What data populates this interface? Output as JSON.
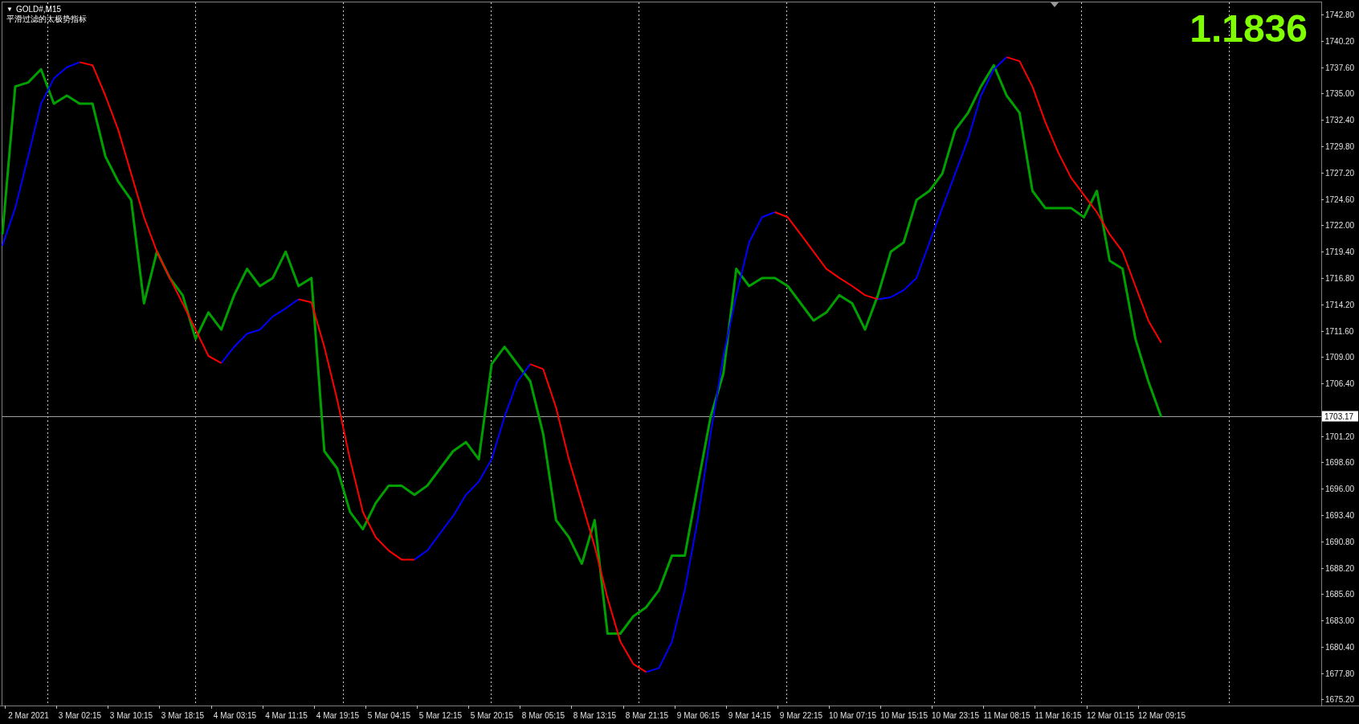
{
  "chart": {
    "header": {
      "arrow": "▼",
      "title": "GOLD#,M15",
      "indicator_name": "平滑过滤的太极势指标"
    },
    "indicator_value": "1.1836",
    "chart_data": {
      "type": "line",
      "categories": [
        null,
        null,
        "2 Mar 2021",
        null,
        null,
        null,
        "3 Mar 02:15",
        null,
        null,
        null,
        "3 Mar 10:15",
        null,
        null,
        null,
        "3 Mar 18:15",
        null,
        null,
        null,
        "4 Mar 03:15",
        null,
        null,
        null,
        "4 Mar 11:15",
        null,
        null,
        null,
        "4 Mar 19:15",
        null,
        null,
        null,
        "5 Mar 04:15",
        null,
        null,
        null,
        "5 Mar 12:15",
        null,
        null,
        null,
        "5 Mar 20:15",
        null,
        null,
        null,
        "8 Mar 05:15",
        null,
        null,
        null,
        "8 Mar 13:15",
        null,
        null,
        null,
        "8 Mar 21:15",
        null,
        null,
        null,
        "9 Mar 06:15",
        null,
        null,
        null,
        "9 Mar 14:15",
        null,
        null,
        null,
        "9 Mar 22:15",
        null,
        null,
        null,
        "10 Mar 07:15",
        null,
        null,
        null,
        "10 Mar 15:15",
        null,
        null,
        null,
        "10 Mar 23:15",
        null,
        null,
        null,
        "11 Mar 08:15",
        null,
        null,
        null,
        "11 Mar 16:15",
        null,
        null,
        null,
        "12 Mar 01:15",
        null,
        null,
        null,
        "12 Mar 09:15"
      ],
      "series": [
        {
          "color": "#00a000",
          "values": [
            1721.1,
            1735.7,
            1736.1,
            1737.4,
            1734.0,
            1734.8,
            1734.0,
            1734.0,
            1728.8,
            1726.3,
            1724.5,
            1714.3,
            1719.4,
            1716.8,
            1715.1,
            1710.8,
            1713.4,
            1711.7,
            1715.1,
            1717.7,
            1716.0,
            1716.8,
            1719.4,
            1716.0,
            1716.8,
            1699.7,
            1698.0,
            1693.7,
            1692.0,
            1694.6,
            1696.3,
            1696.3,
            1695.4,
            1696.3,
            1698.0,
            1699.7,
            1700.6,
            1698.9,
            1708.3,
            1710.0,
            1708.3,
            1706.6,
            1701.4,
            1692.9,
            1691.2,
            1688.6,
            1692.9,
            1681.7,
            1681.7,
            1683.4,
            1684.3,
            1686.0,
            1689.4,
            1689.4,
            1696.3,
            1703.1,
            1707.4,
            1717.7,
            1716.0,
            1716.8,
            1716.8,
            1716.0,
            1714.3,
            1712.6,
            1713.4,
            1715.1,
            1714.3,
            1711.7,
            1715.1,
            1719.4,
            1720.3,
            1724.5,
            1725.4,
            1727.1,
            1731.4,
            1733.1,
            1735.7,
            1737.8,
            1734.8,
            1733.1,
            1725.4,
            1723.7,
            1723.7,
            1723.7,
            1722.8,
            1725.4,
            1718.5,
            1717.7,
            1710.8,
            1706.6,
            1703.1
          ]
        },
        {
          "color": "#0000ff",
          "values": [
            1720.0,
            1723.7,
            1728.8,
            1734.0,
            1736.5,
            1737.6,
            1738.1,
            null,
            null,
            null,
            null,
            null,
            null,
            null,
            null,
            null,
            null,
            1708.4,
            1710.0,
            1711.3,
            1711.7,
            1713.0,
            1713.8,
            1714.7,
            null,
            null,
            null,
            null,
            null,
            null,
            null,
            null,
            1689.0,
            1689.9,
            1691.6,
            1693.3,
            1695.4,
            1696.7,
            1698.9,
            1703.1,
            1706.6,
            1708.3,
            null,
            null,
            null,
            null,
            null,
            null,
            null,
            null,
            1677.9,
            1678.3,
            1680.9,
            1686.0,
            1692.9,
            1701.4,
            1709.1,
            1715.1,
            1720.3,
            1722.8,
            1723.3,
            null,
            null,
            null,
            null,
            null,
            null,
            null,
            1714.7,
            1714.9,
            1715.6,
            1716.8,
            1720.3,
            1723.7,
            1727.1,
            1730.5,
            1734.8,
            1737.4,
            1738.6,
            null,
            null,
            null,
            null,
            null,
            null,
            null,
            null,
            null,
            null,
            null,
            null
          ]
        },
        {
          "color": "#ff0000",
          "values": [
            null,
            null,
            null,
            null,
            null,
            null,
            1738.1,
            1737.8,
            1734.8,
            1731.4,
            1727.1,
            1722.8,
            1719.4,
            1716.8,
            1714.3,
            1711.7,
            1709.1,
            1708.4,
            null,
            null,
            null,
            null,
            null,
            1714.7,
            1714.4,
            1710.0,
            1704.8,
            1698.9,
            1693.7,
            1691.2,
            1689.9,
            1689.0,
            1689.0,
            null,
            null,
            null,
            null,
            null,
            null,
            null,
            null,
            1708.3,
            1707.8,
            1704.0,
            1698.9,
            1694.6,
            1690.3,
            1685.2,
            1680.9,
            1678.7,
            1677.9,
            null,
            null,
            null,
            null,
            null,
            null,
            null,
            null,
            null,
            1723.3,
            1722.8,
            1721.1,
            1719.4,
            1717.7,
            1716.8,
            1716.0,
            1715.1,
            1714.7,
            null,
            null,
            null,
            null,
            null,
            null,
            null,
            null,
            null,
            1738.6,
            1738.2,
            1735.7,
            1732.2,
            1729.2,
            1726.7,
            1725.0,
            1723.3,
            1721.1,
            1719.4,
            1716.0,
            1712.6,
            1710.4
          ]
        }
      ],
      "ylim": [
        1674.6,
        1744.0
      ],
      "grid": true,
      "ref_lines": [
        {
          "axis": "y",
          "value": 1703.17,
          "label": "1703.17"
        }
      ],
      "yticks": [
        {
          "value": 1742.8,
          "label": "1742.80"
        },
        {
          "value": 1740.2,
          "label": "1740.20"
        },
        {
          "value": 1737.6,
          "label": "1737.60"
        },
        {
          "value": 1735.0,
          "label": "1735.00"
        },
        {
          "value": 1732.4,
          "label": "1732.40"
        },
        {
          "value": 1729.8,
          "label": "1729.80"
        },
        {
          "value": 1727.2,
          "label": "1727.20"
        },
        {
          "value": 1724.6,
          "label": "1724.60"
        },
        {
          "value": 1722.0,
          "label": "1722.00"
        },
        {
          "value": 1719.4,
          "label": "1719.40"
        },
        {
          "value": 1716.8,
          "label": "1716.80"
        },
        {
          "value": 1714.2,
          "label": "1714.20"
        },
        {
          "value": 1711.6,
          "label": "1711.60"
        },
        {
          "value": 1709.0,
          "label": "1709.00"
        },
        {
          "value": 1706.4,
          "label": "1706.40"
        },
        {
          "value": 1701.2,
          "label": "1701.20"
        },
        {
          "value": 1698.6,
          "label": "1698.60"
        },
        {
          "value": 1696.0,
          "label": "1696.00"
        },
        {
          "value": 1693.4,
          "label": "1693.40"
        },
        {
          "value": 1690.8,
          "label": "1690.80"
        },
        {
          "value": 1688.2,
          "label": "1688.20"
        },
        {
          "value": 1685.6,
          "label": "1685.60"
        },
        {
          "value": 1683.0,
          "label": "1683.00"
        },
        {
          "value": 1680.4,
          "label": "1680.40"
        },
        {
          "value": 1677.8,
          "label": "1677.80"
        },
        {
          "value": 1675.2,
          "label": "1675.20"
        }
      ]
    }
  }
}
